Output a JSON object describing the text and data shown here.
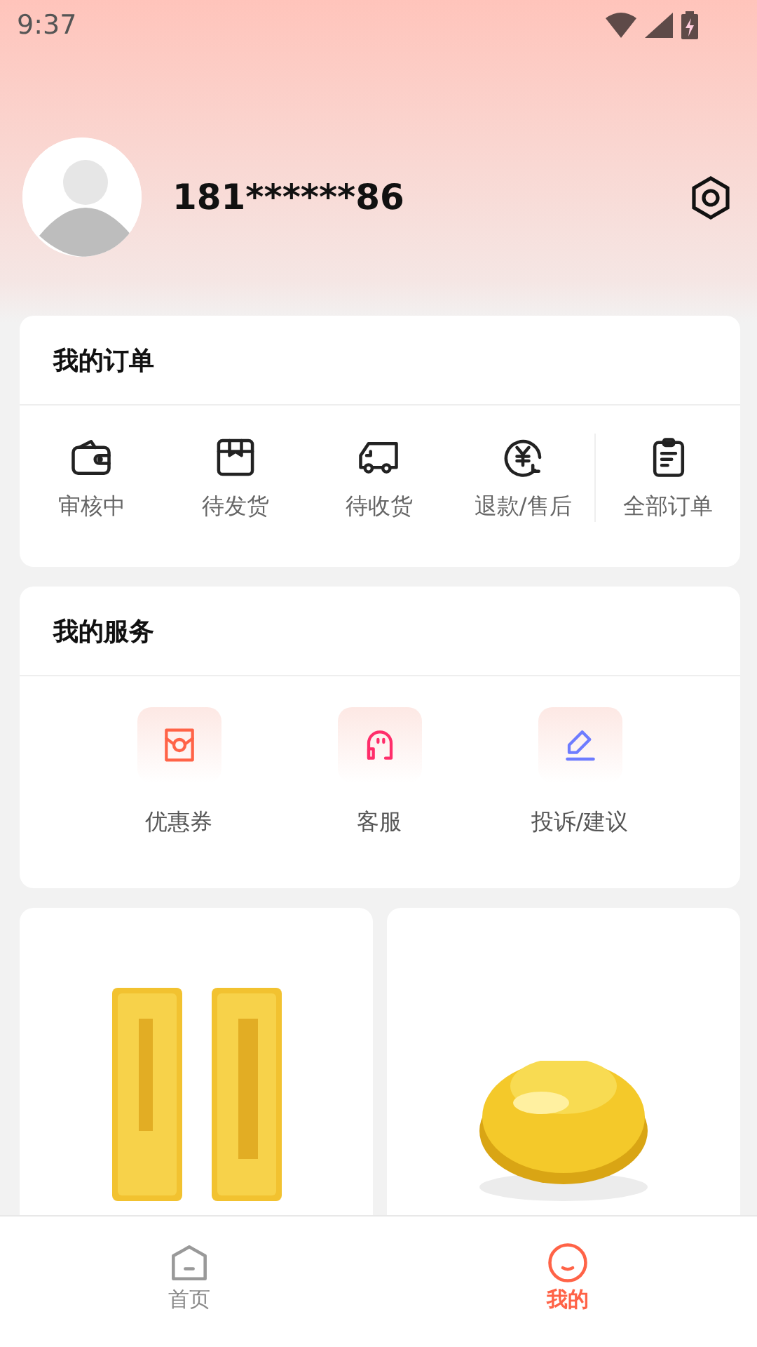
{
  "status_bar": {
    "time": "9:37"
  },
  "profile": {
    "phone": "181******86"
  },
  "orders": {
    "title": "我的订单",
    "items": [
      {
        "label": "审核中",
        "kind": "wallet"
      },
      {
        "label": "待发货",
        "kind": "box"
      },
      {
        "label": "待收货",
        "kind": "truck"
      },
      {
        "label": "退款/售后",
        "kind": "refund"
      },
      {
        "label": "全部订单",
        "kind": "clipboard"
      }
    ]
  },
  "services": {
    "title": "我的服务",
    "items": [
      {
        "label": "优惠券",
        "kind": "coupon"
      },
      {
        "label": "客服",
        "kind": "support"
      },
      {
        "label": "投诉/建议",
        "kind": "pencil"
      }
    ]
  },
  "nav": [
    {
      "label": "首页",
      "kind": "home",
      "selected": false
    },
    {
      "label": "我的",
      "kind": "me",
      "selected": true
    }
  ]
}
